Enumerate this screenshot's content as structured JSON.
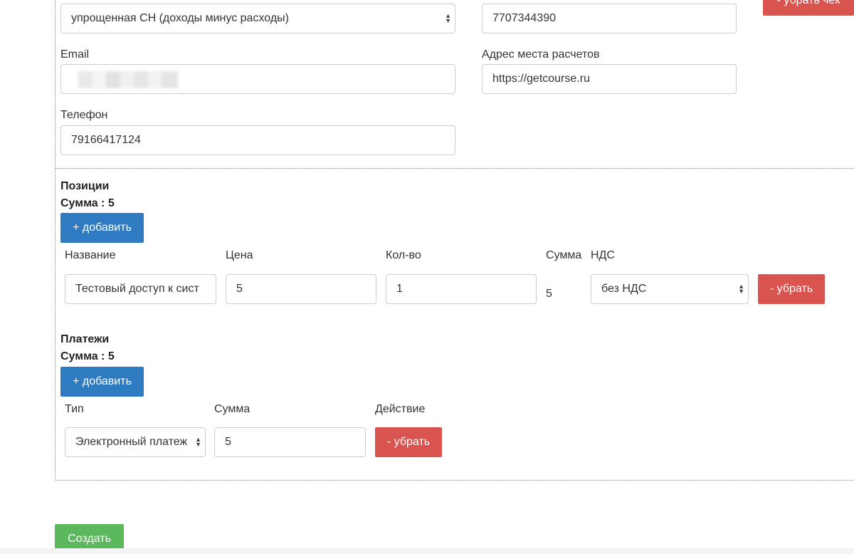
{
  "receipt": {
    "tax_system_value": "упрощенная СН (доходы минус расходы)",
    "inn_value": "7707344390",
    "remove_receipt_label": "- убрать чек",
    "email_label": "Email",
    "email_value": "",
    "address_label": "Адрес места расчетов",
    "address_value": "https://getcourse.ru",
    "phone_label": "Телефон",
    "phone_value": "79166417124"
  },
  "positions": {
    "title": "Позиции",
    "sum_label": "Сумма : 5",
    "add_label": "+ добавить",
    "columns": {
      "name": "Название",
      "price": "Цена",
      "qty": "Кол-во",
      "sum": "Сумма",
      "vat": "НДС"
    },
    "rows": [
      {
        "name": "Тестовый доступ к сист",
        "price": "5",
        "qty": "1",
        "sum": "5",
        "vat": "без НДС",
        "remove_label": "- убрать"
      }
    ]
  },
  "payments": {
    "title": "Платежи",
    "sum_label": "Сумма : 5",
    "add_label": "+ добавить",
    "columns": {
      "type": "Тип",
      "amount": "Сумма",
      "action": "Действие"
    },
    "rows": [
      {
        "type": "Электронный платеж",
        "amount": "5",
        "remove_label": "- убрать"
      }
    ]
  },
  "create_label": "Создать",
  "colors": {
    "primary": "#2f7bc1",
    "danger": "#d9534f",
    "success": "#5cb85c"
  },
  "icons": {
    "select_arrows": "updown-chevron-icon"
  }
}
